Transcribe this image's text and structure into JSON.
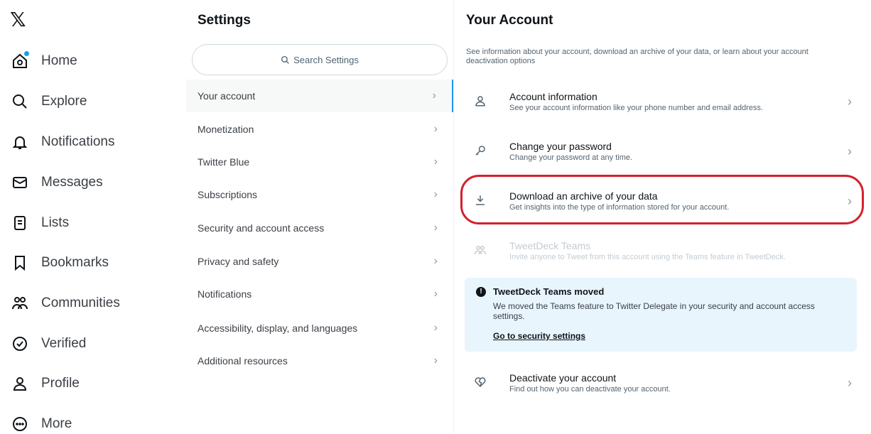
{
  "nav": {
    "logo": "𝕏",
    "items": [
      {
        "label": "Home",
        "icon": "home-icon"
      },
      {
        "label": "Explore",
        "icon": "search-icon"
      },
      {
        "label": "Notifications",
        "icon": "bell-icon"
      },
      {
        "label": "Messages",
        "icon": "mail-icon"
      },
      {
        "label": "Lists",
        "icon": "list-icon"
      },
      {
        "label": "Bookmarks",
        "icon": "bookmark-icon"
      },
      {
        "label": "Communities",
        "icon": "people-icon"
      },
      {
        "label": "Verified",
        "icon": "verified-icon"
      },
      {
        "label": "Profile",
        "icon": "person-icon"
      },
      {
        "label": "More",
        "icon": "more-circle-icon"
      }
    ]
  },
  "settings": {
    "title": "Settings",
    "search_placeholder": "Search Settings",
    "items": [
      {
        "label": "Your account"
      },
      {
        "label": "Monetization"
      },
      {
        "label": "Twitter Blue"
      },
      {
        "label": "Subscriptions"
      },
      {
        "label": "Security and account access"
      },
      {
        "label": "Privacy and safety"
      },
      {
        "label": "Notifications"
      },
      {
        "label": "Accessibility, display, and languages"
      },
      {
        "label": "Additional resources"
      }
    ]
  },
  "account": {
    "title": "Your Account",
    "description": "See information about your account, download an archive of your data, or learn about your account deactivation options",
    "rows": [
      {
        "label": "Account information",
        "sub": "See your account information like your phone number and email address.",
        "icon": "person-icon"
      },
      {
        "label": "Change your password",
        "sub": "Change your password at any time.",
        "icon": "key-icon"
      },
      {
        "label": "Download an archive of your data",
        "sub": "Get insights into the type of information stored for your account.",
        "icon": "download-icon"
      },
      {
        "label": "TweetDeck Teams",
        "sub": "Invite anyone to Tweet from this account using the Teams feature in TweetDeck.",
        "icon": "team-icon"
      },
      {
        "label": "Deactivate your account",
        "sub": "Find out how you can deactivate your account.",
        "icon": "broken-heart-icon"
      }
    ],
    "notice": {
      "icon_glyph": "!",
      "title": "TweetDeck Teams moved",
      "body": "We moved the Teams feature to Twitter Delegate in your security and account access settings.",
      "link": "Go to security settings"
    }
  },
  "colors": {
    "accent": "#1d9bf0",
    "highlight": "#d4202f",
    "notice_bg": "#e8f5fd"
  },
  "chevron": "›"
}
